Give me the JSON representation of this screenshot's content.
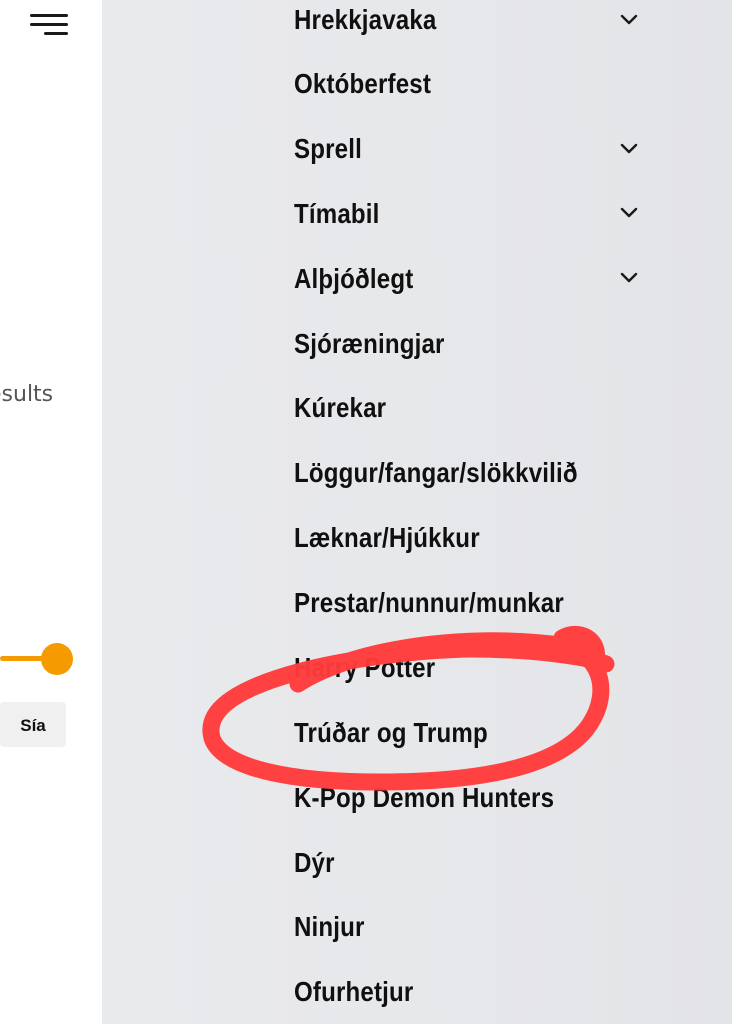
{
  "background_page": {
    "results_text": "esults",
    "filter_button_label": "Sía",
    "slider_color": "#f59b00"
  },
  "menu": {
    "items": [
      {
        "label": "Hrekkjavaka",
        "has_submenu": true
      },
      {
        "label": "Októberfest",
        "has_submenu": false
      },
      {
        "label": "Sprell",
        "has_submenu": true
      },
      {
        "label": "Tímabil",
        "has_submenu": true
      },
      {
        "label": "Alþjóðlegt",
        "has_submenu": true
      },
      {
        "label": "Sjóræningjar",
        "has_submenu": false
      },
      {
        "label": "Kúrekar",
        "has_submenu": false
      },
      {
        "label": "Löggur/fangar/slökkvilið",
        "has_submenu": false
      },
      {
        "label": "Læknar/Hjúkkur",
        "has_submenu": false
      },
      {
        "label": "Prestar/nunnur/munkar",
        "has_submenu": false
      },
      {
        "label": "Harry Potter",
        "has_submenu": false
      },
      {
        "label": "Trúðar og Trump",
        "has_submenu": false
      },
      {
        "label": "K-Pop Demon Hunters",
        "has_submenu": false
      },
      {
        "label": "Dýr",
        "has_submenu": false
      },
      {
        "label": "Ninjur",
        "has_submenu": false
      },
      {
        "label": "Ofurhetjur",
        "has_submenu": false
      }
    ]
  },
  "annotation": {
    "color": "#ff3b3b",
    "circled_item": "Trúðar og Trump"
  }
}
